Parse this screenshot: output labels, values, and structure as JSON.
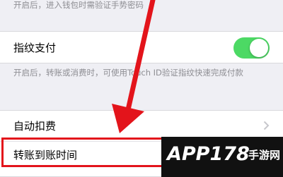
{
  "top_note": "开启后，进入钱包时需验证手势密码",
  "fingerprint": {
    "label": "指纹支付",
    "enabled": true,
    "note": "开启后，转账或消费时，可使用Touch ID验证指纹快速完成付款"
  },
  "auto_deduct": {
    "label": "自动扣费"
  },
  "transfer_time": {
    "label": "转账到账时间"
  },
  "watermark": {
    "brand": "APP178",
    "suffix": "手游网"
  },
  "colors": {
    "switch_on": "#4cd964",
    "highlight": "#e3141b"
  },
  "icons": {
    "chevron": "chevron-right-icon",
    "arrow": "pointer-arrow-annotation"
  }
}
